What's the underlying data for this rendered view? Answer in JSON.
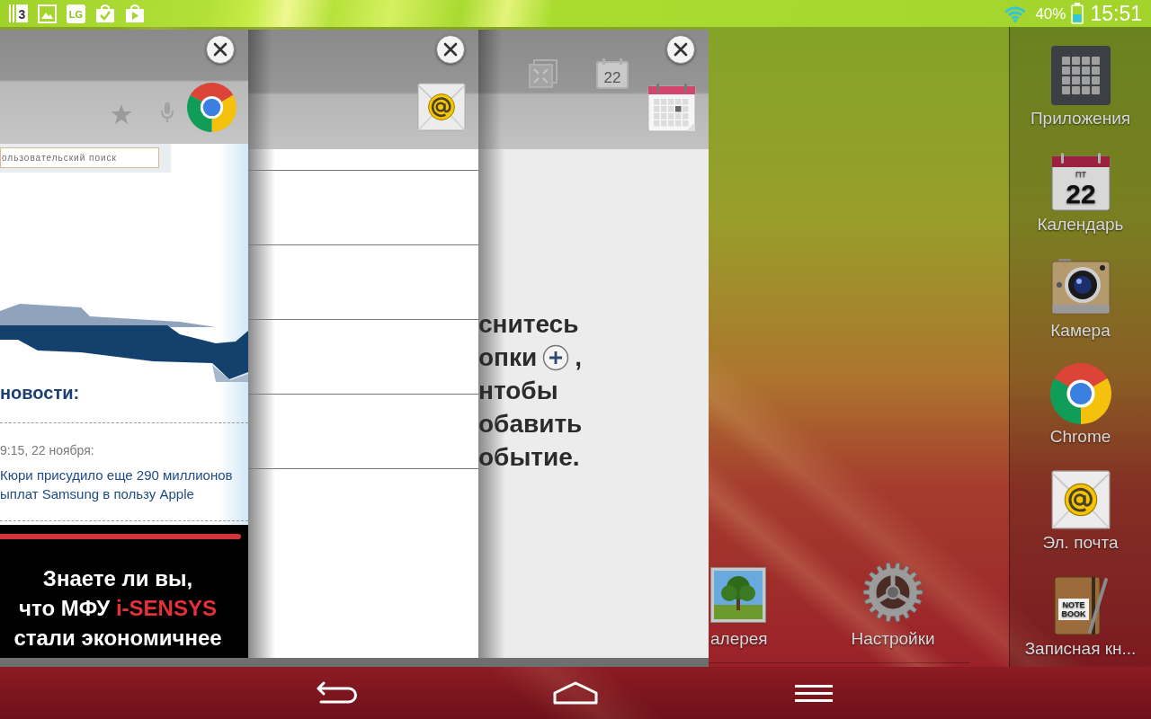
{
  "status_bar": {
    "notifications": [
      {
        "kind": "count",
        "text": "3"
      },
      {
        "kind": "picture"
      },
      {
        "kind": "badge",
        "text": "LG"
      },
      {
        "kind": "task"
      },
      {
        "kind": "store"
      }
    ],
    "battery_percent": "40%",
    "time": "15:51"
  },
  "recent_apps": [
    {
      "kind": "browser",
      "search": {
        "placeholder": "ользовательский поиск"
      },
      "heading": "новости:",
      "date": "9:15, 22 ноября:",
      "headline_lines": [
        "Кюри присудило еще 290 миллионов",
        "ыплат Samsung в пользу Apple"
      ],
      "ad": {
        "lines": [
          [
            {
              "text": "Знаете ли вы,",
              "highlight": false
            }
          ],
          [
            {
              "text": "что МФУ",
              "highlight": false
            },
            {
              "text": "i-SENSYS",
              "highlight": true
            }
          ],
          [
            {
              "text": "стали экономичнее",
              "highlight": false
            }
          ]
        ]
      }
    },
    {
      "kind": "email"
    },
    {
      "kind": "calendar",
      "toolbar": [
        {
          "kind": "collapse"
        },
        {
          "kind": "date",
          "text": "22"
        }
      ],
      "hint_lines": [
        [
          {
            "kind": "text",
            "text": "снитесь"
          }
        ],
        [
          {
            "kind": "text",
            "text": "опки"
          },
          {
            "kind": "plus"
          },
          {
            "kind": "text",
            "text": ","
          }
        ],
        [
          {
            "kind": "text",
            "text": "нтобы"
          }
        ],
        [
          {
            "kind": "text",
            "text": "обавить"
          }
        ],
        [
          {
            "kind": "text",
            "text": "обытие."
          }
        ]
      ]
    }
  ],
  "home_shortcuts": [
    {
      "kind": "gallery",
      "label": "алерея"
    },
    {
      "kind": "settings",
      "label": "Настройки"
    }
  ],
  "dock": [
    {
      "kind": "apps",
      "label": "Приложения"
    },
    {
      "kind": "calendar",
      "label": "Календарь",
      "weekday": "ПТ",
      "day": "22"
    },
    {
      "kind": "camera",
      "label": "Камера"
    },
    {
      "kind": "chrome",
      "label": "Chrome"
    },
    {
      "kind": "email",
      "label": "Эл. почта"
    },
    {
      "kind": "notebook",
      "label": "Записная кн...",
      "cover_lines": [
        "NOTE",
        "BOOK"
      ]
    }
  ],
  "navigation_bar": [
    {
      "kind": "back"
    },
    {
      "kind": "home"
    },
    {
      "kind": "menu"
    }
  ]
}
